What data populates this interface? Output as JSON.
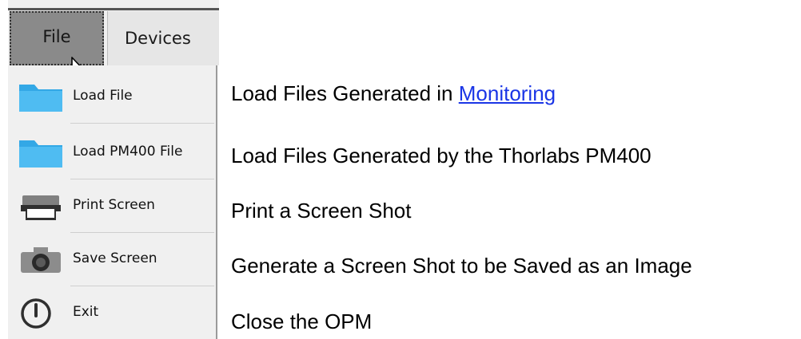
{
  "menubar": {
    "file_label": "File",
    "devices_label": "Devices"
  },
  "file_menu": {
    "items": [
      {
        "label": "Load File",
        "icon": "folder-icon"
      },
      {
        "label": "Load PM400 File",
        "icon": "folder-icon"
      },
      {
        "label": "Print Screen",
        "icon": "printer-icon"
      },
      {
        "label": "Save Screen",
        "icon": "camera-icon"
      },
      {
        "label": "Exit",
        "icon": "power-icon"
      }
    ]
  },
  "descriptions": {
    "load_file_prefix": "Load Files Generated in ",
    "load_file_link": "Monitoring",
    "load_pm400": "Load Files Generated by the Thorlabs PM400",
    "print_screen": "Print a Screen Shot",
    "save_screen": "Generate a Screen Shot to be Saved as an Image",
    "exit": "Close the OPM"
  },
  "colors": {
    "file_menu_active": "#8a8a8a",
    "menu_background": "#f0f0f0",
    "folder_icon": "#33a8e6",
    "link": "#1a35e6"
  }
}
